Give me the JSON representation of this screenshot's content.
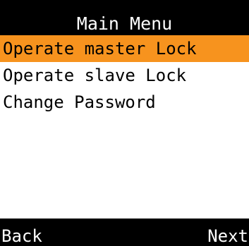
{
  "header": {
    "title": "Main Menu"
  },
  "menu": {
    "items": [
      {
        "label": "Operate master Lock",
        "selected": true
      },
      {
        "label": "Operate slave Lock",
        "selected": false
      },
      {
        "label": "Change Password",
        "selected": false
      }
    ]
  },
  "softkeys": {
    "left": "Back",
    "right": "Next"
  },
  "colors": {
    "highlight": "#f7931e",
    "bar_background": "#000000",
    "bar_text": "#ffffff",
    "screen_background": "#ffffff"
  }
}
